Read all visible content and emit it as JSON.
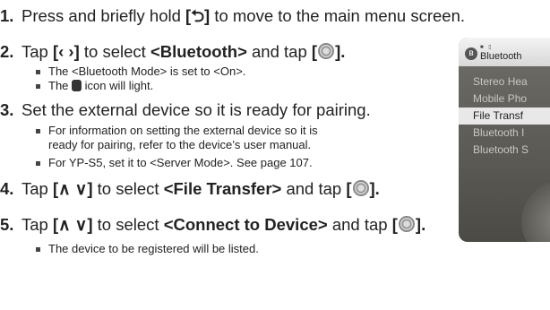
{
  "steps": [
    {
      "num": "1.",
      "parts": [
        "Press and briefly hold ",
        "[⮌]",
        " to move to the main menu screen."
      ]
    },
    {
      "num": "2.",
      "parts": [
        "Tap ",
        "[‹ ›]",
        " to select ",
        "<Bluetooth>",
        " and tap ",
        "[",
        ""
      ]
    },
    {
      "num": "3.",
      "text": "Set the external device so it is ready for pairing."
    },
    {
      "num": "4.",
      "parts": [
        "Tap ",
        "[∧ ∨]",
        " to select ",
        "<File Transfer>",
        " and tap ",
        "[",
        ""
      ]
    },
    {
      "num": "5.",
      "parts": [
        "Tap ",
        "[∧ ∨]",
        " to select ",
        "<Connect to Device>",
        " and tap ",
        "[",
        ""
      ]
    }
  ],
  "bullets2": [
    "The <Bluetooth Mode> is set to <On>.",
    "The ",
    " icon will light."
  ],
  "bullets3": [
    "For information on setting the external device so it is",
    "ready for pairing, refer to the device’s user manual.",
    "For YP-S5, set it to <Server Mode>. See page 107."
  ],
  "bullet5": "The device to be registered will be listed.",
  "device": {
    "title": "Bluetooth",
    "indicators": "■ ▯",
    "bt_glyph": "ʙ",
    "menu": [
      "Stereo Hea",
      "Mobile Pho",
      "File Transf",
      "Bluetooth I",
      "Bluetooth S"
    ],
    "selected_index": 2
  }
}
